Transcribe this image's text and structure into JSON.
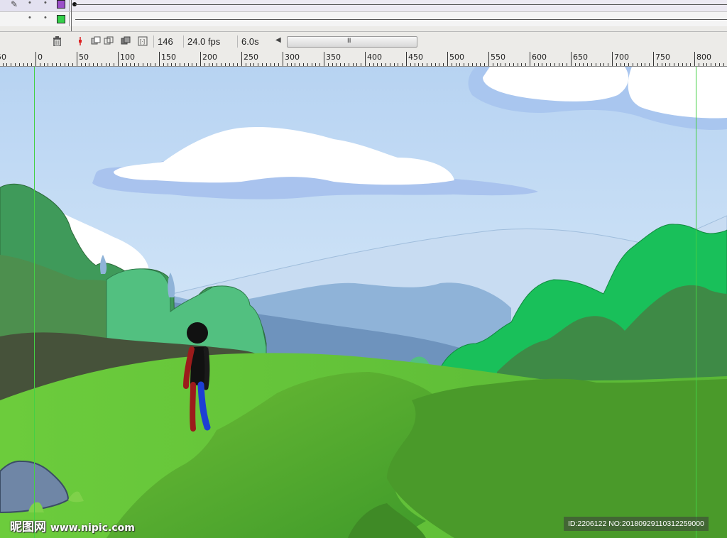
{
  "layers": [
    {
      "color": "#9b4fc9",
      "has_pencil": true
    },
    {
      "color": "#34d04a",
      "has_pencil": false
    }
  ],
  "timeline": {
    "current_frame": "146",
    "frame_rate": "24.0 fps",
    "elapsed_time": "6.0s",
    "scroll_grip": "III"
  },
  "ruler": {
    "labels": [
      "50",
      "0",
      "50",
      "100",
      "150",
      "200",
      "250",
      "300",
      "350",
      "400",
      "450",
      "500",
      "550",
      "600",
      "650",
      "700",
      "750",
      "800"
    ]
  },
  "stage": {
    "colors": {
      "sky_top": "#b7d3f2",
      "sky_bottom": "#e6f3fb",
      "grass_light": "#6cc83a",
      "grass_dark": "#4a9a2a",
      "bush_green": "#19c05a",
      "mountain": "#8fb3d8",
      "guide": "#44d044"
    }
  },
  "watermark": {
    "logo_text": "昵图网",
    "site_text": "www.nipic.com",
    "id_text": "ID:2206122 NO:20180929110312259000"
  }
}
